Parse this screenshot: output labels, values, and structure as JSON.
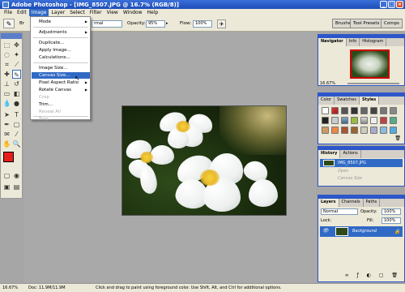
{
  "window": {
    "title": "Adobe Photoshop - [IMG_8507.JPG @ 16.7% (RGB/8)]"
  },
  "menubar": [
    "File",
    "Edit",
    "Image",
    "Layer",
    "Select",
    "Filter",
    "View",
    "Window",
    "Help"
  ],
  "menubar_active": "Image",
  "options": {
    "mode_value": "rmal",
    "opacity_label": "Opacity:",
    "opacity_value": "95%",
    "flow_label": "Flow:",
    "flow_value": "100%",
    "brush_label": "Br",
    "panel_tabs": [
      "Brushes",
      "Tool Presets",
      "Comps"
    ]
  },
  "image_menu": {
    "items": [
      {
        "label": "Mode",
        "submenu": true
      },
      {
        "label": "Adjustments",
        "submenu": true
      },
      {
        "label": "Duplicate..."
      },
      {
        "label": "Apply Image..."
      },
      {
        "label": "Calculations..."
      },
      {
        "label": "Image Size..."
      },
      {
        "label": "Canvas Size...",
        "highlighted": true
      },
      {
        "label": "Pixel Aspect Ratio",
        "submenu": true
      },
      {
        "label": "Rotate Canvas",
        "submenu": true
      },
      {
        "label": "Crop",
        "disabled": true
      },
      {
        "label": "Trim..."
      },
      {
        "label": "Reveal All",
        "disabled": true
      },
      {
        "label": "Trap...",
        "disabled": true
      }
    ]
  },
  "navigator": {
    "tabs": [
      "Navigator",
      "Info",
      "Histogram"
    ],
    "zoom": "16.67%"
  },
  "color_panel": {
    "tabs": [
      "Color",
      "Swatches",
      "Styles"
    ]
  },
  "history": {
    "tabs": [
      "History",
      "Actions"
    ],
    "snapshot": "IMG_8507.JPG",
    "states": [
      "Open",
      "Canvas Size"
    ]
  },
  "layers": {
    "tabs": [
      "Layers",
      "Channels",
      "Paths"
    ],
    "mode": "Normal",
    "opacity_label": "Opacity:",
    "opacity_value": "100%",
    "lock_label": "Lock:",
    "fill_label": "Fill:",
    "fill_value": "100%",
    "layer_name": "Background"
  },
  "status": {
    "zoom": "16.67%",
    "doc": "Doc: 11.9M/11.9M",
    "hint": "Click and drag to paint using foreground color. Use Shift, Alt, and Ctrl for additional options."
  },
  "colors": {
    "accent": "#316ac5",
    "foreground": "#e81c1c",
    "title_blue": "#1d4db8"
  }
}
